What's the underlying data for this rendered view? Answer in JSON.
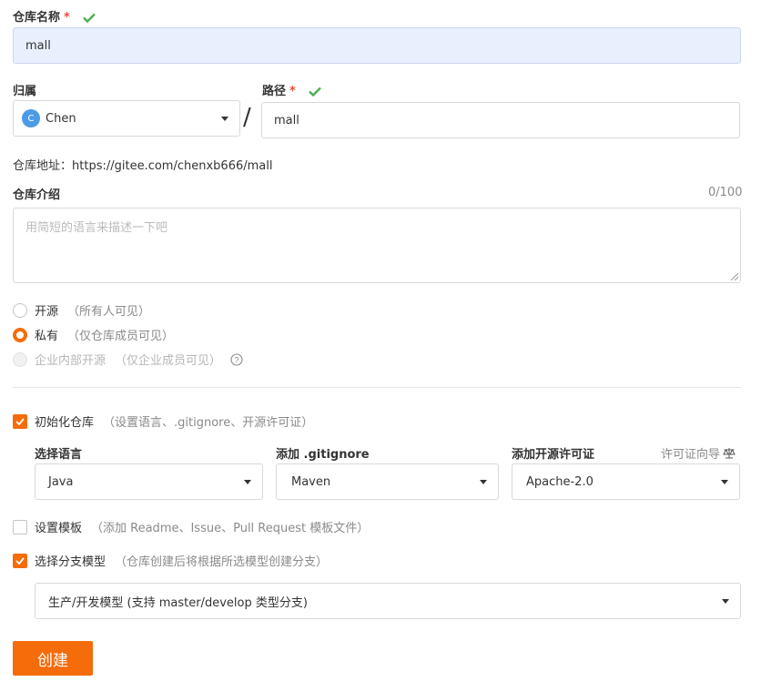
{
  "repo_name": {
    "label": "仓库名称",
    "required": "*",
    "value": "mall"
  },
  "owner": {
    "label": "归属",
    "avatar_letter": "C",
    "value": "Chen"
  },
  "path_sep": "/",
  "path": {
    "label": "路径",
    "required": "*",
    "value": "mall"
  },
  "repo_address": {
    "label": "仓库地址：",
    "url": "https://gitee.com/chenxb666/mall"
  },
  "description": {
    "label": "仓库介绍",
    "counter": "0/100",
    "placeholder": "用简短的语言来描述一下吧"
  },
  "visibility": [
    {
      "text": "开源",
      "hint": "（所有人可见）"
    },
    {
      "text": "私有",
      "hint": "（仅仓库成员可见）"
    },
    {
      "text": "企业内部开源",
      "hint": "（仅企业成员可见）"
    }
  ],
  "init_repo": {
    "text": "初始化仓库",
    "hint": "（设置语言、.gitignore、开源许可证）"
  },
  "language": {
    "label": "选择语言",
    "value": "Java"
  },
  "gitignore": {
    "label": "添加 .gitignore",
    "value": "Maven"
  },
  "license": {
    "label": "添加开源许可证",
    "wizard": "许可证向导",
    "value": "Apache-2.0"
  },
  "template": {
    "text": "设置模板",
    "hint": "（添加 Readme、Issue、Pull Request 模板文件）"
  },
  "branch_model": {
    "text": "选择分支模型",
    "hint": "（仓库创建后将根据所选模型创建分支）",
    "value": "生产/开发模型 (支持 master/develop 类型分支)"
  },
  "submit_label": "创建",
  "colors": {
    "accent": "#f56c0b",
    "success": "#4caf50",
    "required": "#e74c3c"
  }
}
